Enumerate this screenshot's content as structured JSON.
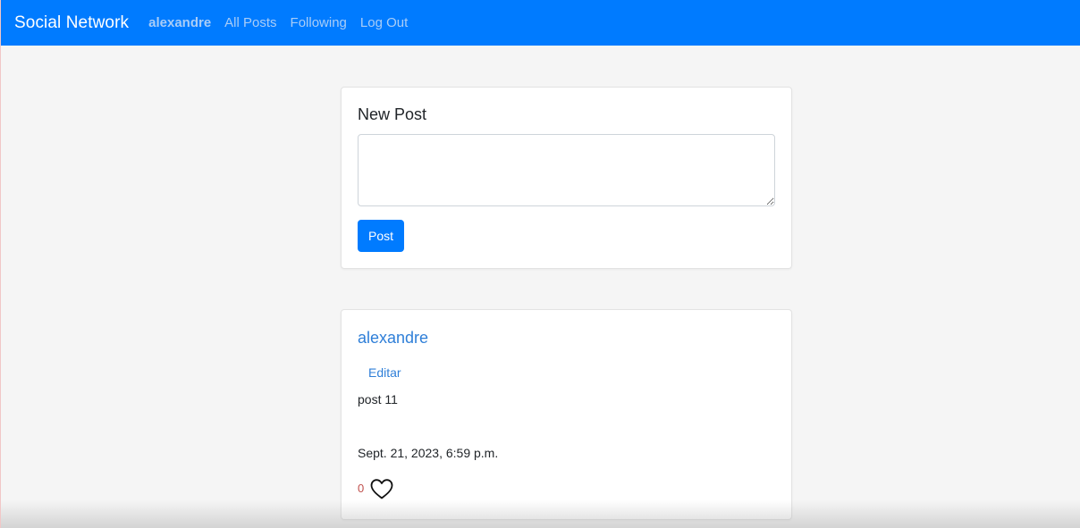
{
  "navbar": {
    "brand": "Social Network",
    "username": "alexandre",
    "links": [
      "All Posts",
      "Following",
      "Log Out"
    ],
    "background_color": "#007bff"
  },
  "new_post": {
    "title": "New Post",
    "textarea_value": "",
    "button_label": "Post"
  },
  "posts": [
    {
      "author": "alexandre",
      "edit_label": "Editar",
      "content": "post 11",
      "timestamp": "Sept. 21, 2023, 6:59 p.m.",
      "like_count": "0",
      "like_icon": "heart-outline-icon"
    }
  ]
}
